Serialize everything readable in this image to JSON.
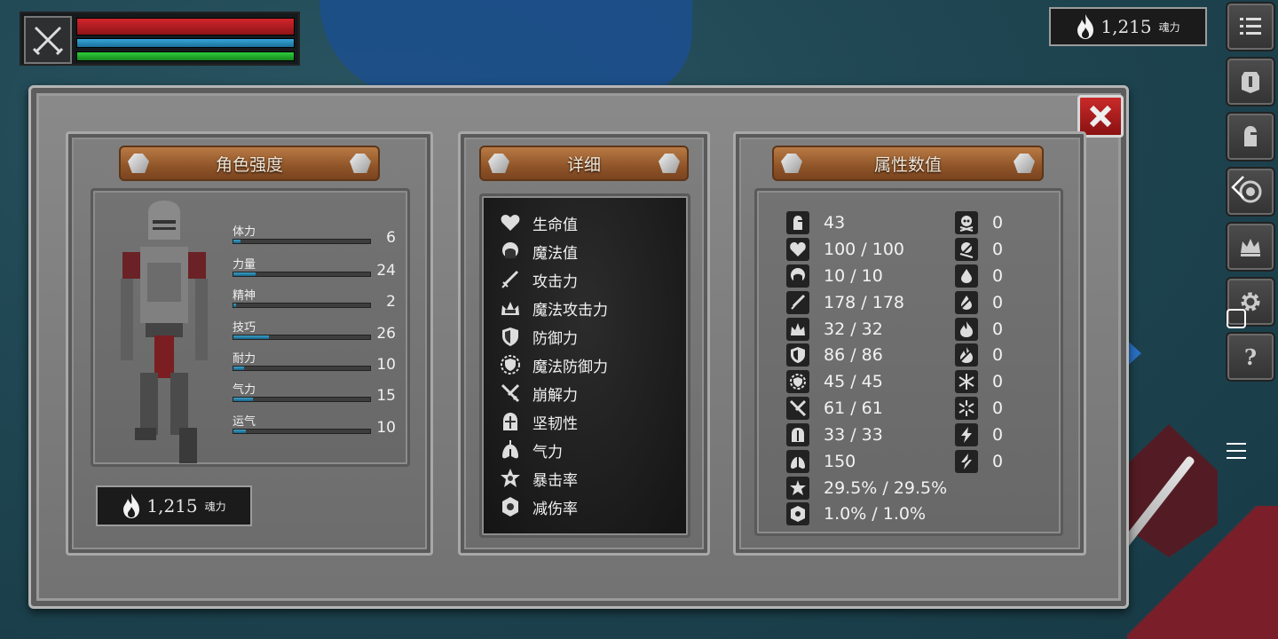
{
  "hud": {
    "health_fraction": 1.0,
    "mana_fraction": 1.0,
    "stamina_fraction": 1.0
  },
  "souls": {
    "amount": "1,215",
    "label": "魂力"
  },
  "panel_titles": {
    "character": "角色强度",
    "details": "详细",
    "attributes": "属性数值"
  },
  "character_stats": [
    {
      "label": "体力",
      "value": "6",
      "fill": 0.05
    },
    {
      "label": "力量",
      "value": "24",
      "fill": 0.16
    },
    {
      "label": "精神",
      "value": "2",
      "fill": 0.02
    },
    {
      "label": "技巧",
      "value": "26",
      "fill": 0.26
    },
    {
      "label": "耐力",
      "value": "10",
      "fill": 0.08
    },
    {
      "label": "气力",
      "value": "15",
      "fill": 0.14
    },
    {
      "label": "运气",
      "value": "10",
      "fill": 0.09
    }
  ],
  "details": [
    {
      "label": "生命值",
      "icon": "heart-icon"
    },
    {
      "label": "魔法值",
      "icon": "head-icon"
    },
    {
      "label": "攻击力",
      "icon": "sword-icon"
    },
    {
      "label": "魔法攻击力",
      "icon": "crown-spell-icon"
    },
    {
      "label": "防御力",
      "icon": "shield-icon"
    },
    {
      "label": "魔法防御力",
      "icon": "magic-shield-icon"
    },
    {
      "label": "崩解力",
      "icon": "break-icon"
    },
    {
      "label": "坚韧性",
      "icon": "helmet-icon"
    },
    {
      "label": "气力",
      "icon": "lungs-icon"
    },
    {
      "label": "暴击率",
      "icon": "critical-star-icon"
    },
    {
      "label": "减伤率",
      "icon": "damage-reduction-icon"
    }
  ],
  "attributes": [
    {
      "value": "43",
      "icon": "armor-level-icon"
    },
    {
      "value": "100 / 100",
      "icon": "heart-icon"
    },
    {
      "value": "10 / 10",
      "icon": "head-icon"
    },
    {
      "value": "178 / 178",
      "icon": "sword-icon"
    },
    {
      "value": "32 / 32",
      "icon": "crown-spell-icon"
    },
    {
      "value": "86 / 86",
      "icon": "shield-icon"
    },
    {
      "value": "45 / 45",
      "icon": "magic-shield-icon"
    },
    {
      "value": "61 / 61",
      "icon": "break-icon"
    },
    {
      "value": "33 / 33",
      "icon": "helmet-icon"
    },
    {
      "value": "150",
      "icon": "lungs-icon"
    },
    {
      "value": "29.5% / 29.5%",
      "icon": "critical-star-icon"
    },
    {
      "value": "1.0% / 1.0%",
      "icon": "damage-reduction-icon"
    }
  ],
  "resistances": [
    {
      "value": "0",
      "icon": "skull-icon"
    },
    {
      "value": "0",
      "icon": "poison-skull-icon"
    },
    {
      "value": "0",
      "icon": "blood-drop-icon"
    },
    {
      "value": "0",
      "icon": "bleed-resist-icon"
    },
    {
      "value": "0",
      "icon": "fire-icon"
    },
    {
      "value": "0",
      "icon": "fire-resist-icon"
    },
    {
      "value": "0",
      "icon": "frost-icon"
    },
    {
      "value": "0",
      "icon": "frost-resist-icon"
    },
    {
      "value": "0",
      "icon": "lightning-icon"
    },
    {
      "value": "0",
      "icon": "lightning-resist-icon"
    }
  ],
  "menu": [
    {
      "icon": "list-icon"
    },
    {
      "icon": "armor-icon"
    },
    {
      "icon": "helmet-icon"
    },
    {
      "icon": "shield-emblem-icon"
    },
    {
      "icon": "crown-icon"
    },
    {
      "icon": "gear-icon"
    },
    {
      "icon": "help-icon"
    }
  ],
  "colors": {
    "health": "#d0262b",
    "mana": "#37a6d6",
    "stamina": "#2ecd3c",
    "close": "#c92a2a",
    "plank": "#9a5e30"
  }
}
